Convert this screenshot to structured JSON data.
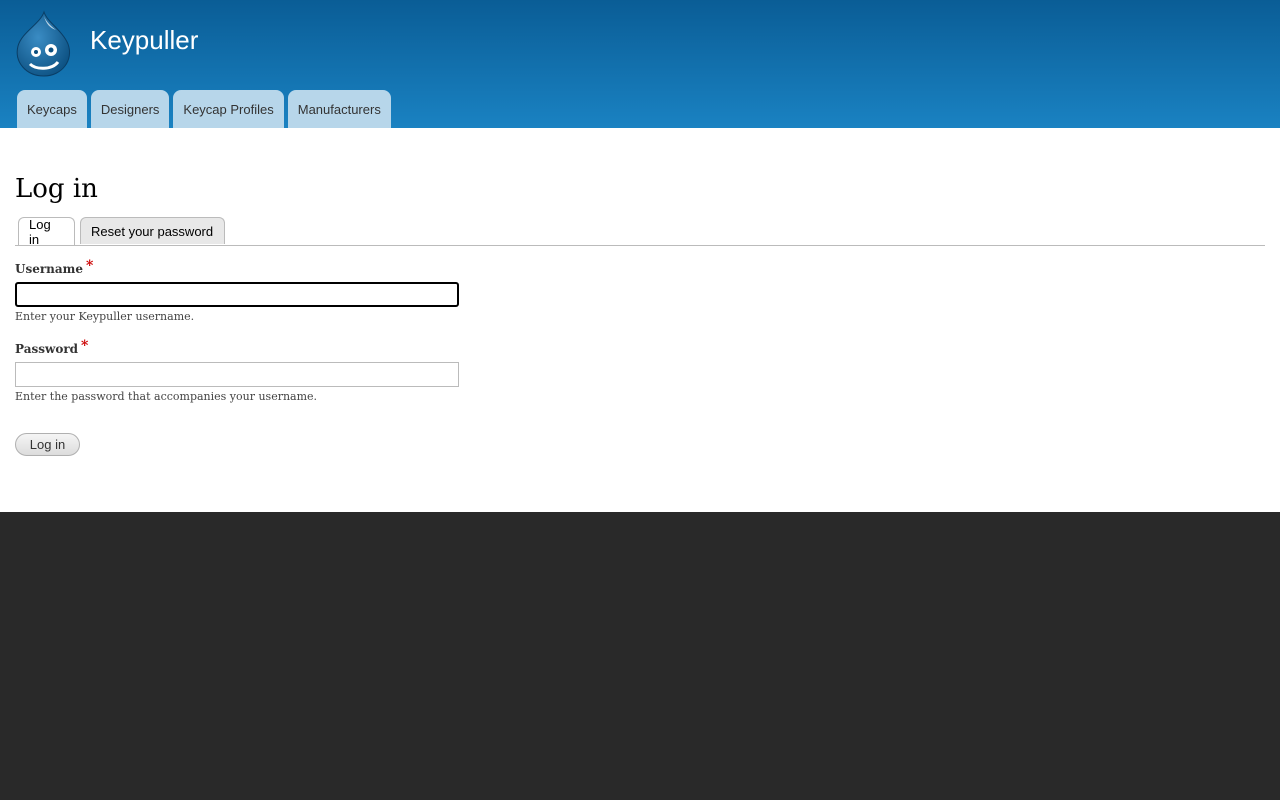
{
  "site": {
    "name": "Keypuller",
    "logo_icon": "drupal-drop-logo-icon"
  },
  "nav": {
    "items": [
      {
        "label": "Keycaps"
      },
      {
        "label": "Designers"
      },
      {
        "label": "Keycap Profiles"
      },
      {
        "label": "Manufacturers"
      }
    ]
  },
  "page": {
    "title": "Log in"
  },
  "tabs": {
    "active": "Log in",
    "reset": "Reset your password"
  },
  "form": {
    "username": {
      "label": "Username",
      "required_mark": "*",
      "value": "",
      "description": "Enter your Keypuller username."
    },
    "password": {
      "label": "Password",
      "required_mark": "*",
      "value": "",
      "description": "Enter the password that accompanies your username."
    },
    "submit_label": "Log in"
  },
  "colors": {
    "header_top": "#0a5d96",
    "header_bottom": "#1a82c2",
    "nav_tab": "#b7d6ea",
    "footer_bg": "#292929",
    "required": "#cc0000"
  }
}
